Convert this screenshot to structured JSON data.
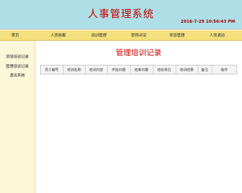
{
  "header": {
    "title": "人事管理系统",
    "datetime": "2016-7-29 10:56:43 PM"
  },
  "nav": {
    "items": [
      {
        "label": "首页"
      },
      {
        "label": "人员档案"
      },
      {
        "label": "培训管理"
      },
      {
        "label": "职称评定"
      },
      {
        "label": "奖惩管理"
      },
      {
        "label": "人员调动"
      }
    ]
  },
  "sidebar": {
    "items": [
      {
        "label": "添加培训记录"
      },
      {
        "label": "管理培训记录"
      },
      {
        "label": "退出系统"
      }
    ]
  },
  "main": {
    "title": "管理培训记录",
    "table": {
      "columns": [
        "员工编号",
        "培训名称",
        "培训内容",
        "开始日期",
        "结束日期",
        "培训单位",
        "培训结果",
        "备注",
        "操作"
      ]
    }
  }
}
